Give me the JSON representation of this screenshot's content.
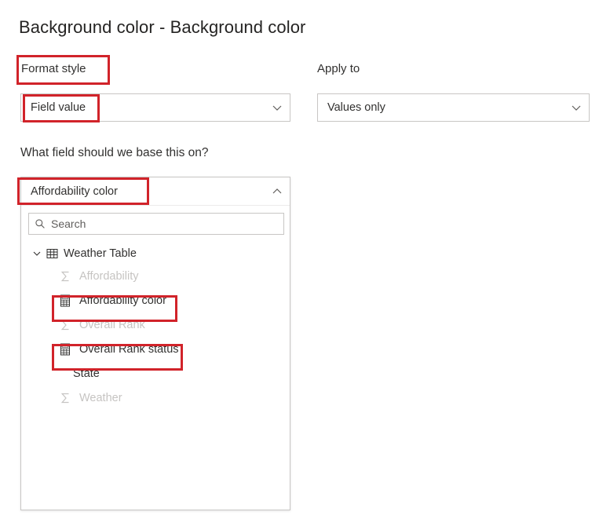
{
  "page": {
    "title": "Background color - Background color"
  },
  "format_style": {
    "label": "Format style",
    "value": "Field value",
    "chevron_icon": "chevron-down-icon"
  },
  "apply_to": {
    "label": "Apply to",
    "value": "Values only",
    "chevron_icon": "chevron-down-icon"
  },
  "base_field": {
    "label": "What field should we base this on?",
    "value": "Affordability color",
    "chevron_icon": "chevron-up-icon",
    "expanded": true
  },
  "search": {
    "placeholder": "Search",
    "value": "",
    "icon": "search-icon"
  },
  "tree": {
    "table": {
      "name": "Weather Table",
      "expander_icon": "chevron-down-icon",
      "table_icon": "table-icon",
      "expanded": true
    },
    "fields": [
      {
        "name": "Affordability",
        "icon": "sigma-icon",
        "disabled": true,
        "highlighted": false
      },
      {
        "name": "Affordability color",
        "icon": "measure-icon",
        "disabled": false,
        "highlighted": true
      },
      {
        "name": "Overall Rank",
        "icon": "sigma-icon",
        "disabled": true,
        "highlighted": false
      },
      {
        "name": "Overall Rank status",
        "icon": "measure-icon",
        "disabled": false,
        "highlighted": true
      },
      {
        "name": "State",
        "icon": "none",
        "disabled": false,
        "highlighted": false
      },
      {
        "name": "Weather",
        "icon": "sigma-icon",
        "disabled": true,
        "highlighted": false
      }
    ]
  },
  "annotations": {
    "color": "#d1232a",
    "boxes": [
      "format-style-label",
      "format-style-value",
      "base-field-value",
      "field-affordability-color",
      "field-overall-rank-status"
    ]
  }
}
